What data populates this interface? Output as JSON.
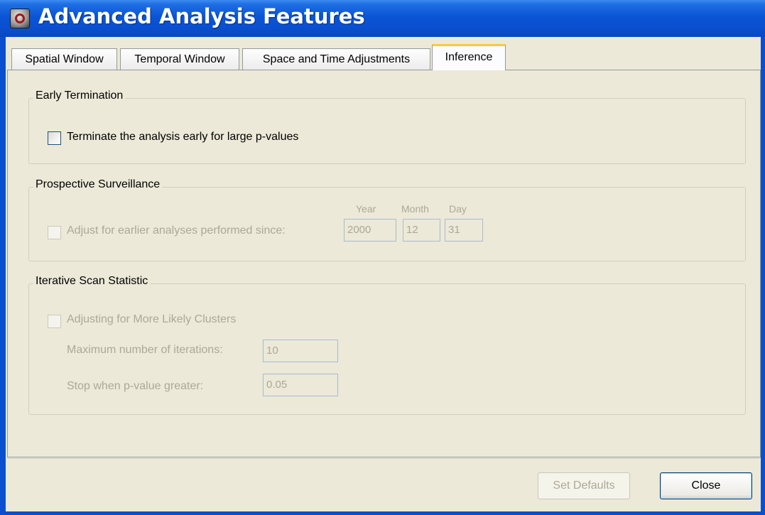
{
  "window": {
    "title": "Advanced Analysis Features"
  },
  "tabs": [
    {
      "label": "Spatial Window",
      "active": false
    },
    {
      "label": "Temporal Window",
      "active": false
    },
    {
      "label": "Space and Time Adjustments",
      "active": false
    },
    {
      "label": "Inference",
      "active": true
    }
  ],
  "early_termination": {
    "legend": "Early Termination",
    "checkbox_label": "Terminate the analysis early for large p-values",
    "checked": false,
    "enabled": true
  },
  "prospective_surveillance": {
    "legend": "Prospective Surveillance",
    "checkbox_label": "Adjust for earlier analyses performed since:",
    "checked": false,
    "enabled": false,
    "year_label": "Year",
    "month_label": "Month",
    "day_label": "Day",
    "year_value": "2000",
    "month_value": "12",
    "day_value": "31"
  },
  "iterative_scan": {
    "legend": "Iterative Scan Statistic",
    "checkbox_label": "Adjusting for More Likely Clusters",
    "checked": false,
    "enabled": false,
    "max_iterations_label": "Maximum number of iterations:",
    "max_iterations_value": "10",
    "stop_pvalue_label": "Stop when p-value greater:",
    "stop_pvalue_value": "0.05"
  },
  "buttons": {
    "set_defaults": "Set Defaults",
    "close": "Close"
  },
  "colors": {
    "title_bar": "#0a55d6",
    "dialog_bg": "#ece9d8",
    "active_tab_highlight": "#ffc83c",
    "disabled_text": "#aca899"
  }
}
